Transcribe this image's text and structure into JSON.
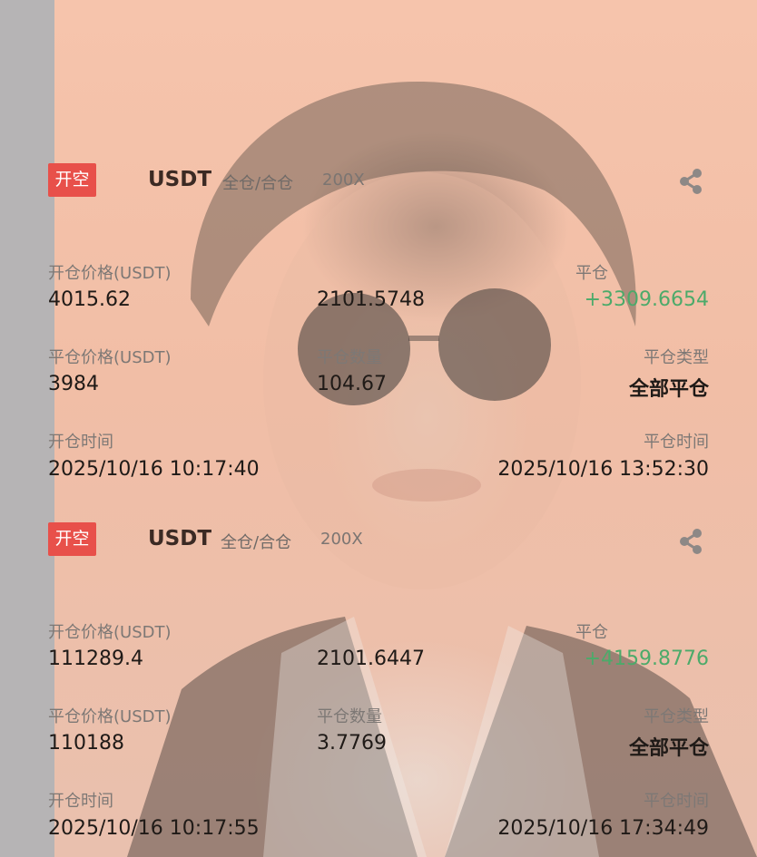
{
  "positions": [
    {
      "side": "开空",
      "coin": "USDT",
      "margin_mode": "全仓/合仓",
      "leverage": "200X",
      "open_price_label": "开仓价格(USDT)",
      "open_price": "4015.62",
      "middle_value": "2101.5748",
      "close_label": "平仓",
      "pnl": "+3309.6654",
      "close_price_label": "平仓价格(USDT)",
      "close_price": "3984",
      "close_qty_label": "平仓数量",
      "close_qty": "104.67",
      "close_type_label": "平仓类型",
      "close_type": "全部平仓",
      "open_time_label": "开仓时间",
      "open_time": "2025/10/16 10:17:40",
      "close_time_label": "平仓时间",
      "close_time": "2025/10/16 13:52:30"
    },
    {
      "side": "开空",
      "coin": "USDT",
      "margin_mode": "全仓/合仓",
      "leverage": "200X",
      "open_price_label": "开仓价格(USDT)",
      "open_price": "111289.4",
      "middle_value": "2101.6447",
      "close_label": "平仓",
      "pnl": "+4159.8776",
      "close_price_label": "平仓价格(USDT)",
      "close_price": "110188",
      "close_qty_label": "平仓数量",
      "close_qty": "3.7769",
      "close_type_label": "平仓类型",
      "close_type": "全部平仓",
      "open_time_label": "开仓时间",
      "open_time": "2025/10/16 10:17:55",
      "close_time_label": "平仓时间",
      "close_time": "2025/10/16 17:34:49"
    }
  ],
  "colors": {
    "badge": "#e8504a",
    "profit": "#4caa6a",
    "background": "#f2c0a8"
  },
  "icons": {
    "share": "share-icon",
    "background_image": "portrait-photo"
  }
}
